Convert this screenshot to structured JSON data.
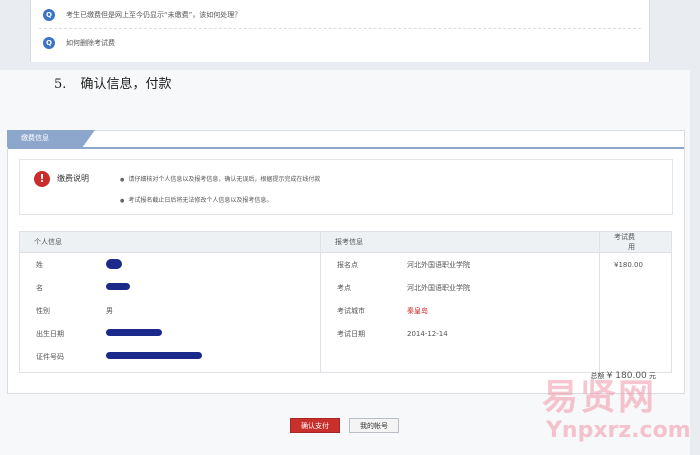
{
  "faq": [
    {
      "icon": "Q",
      "text": "考生已缴费但是网上至今仍显示“未缴费”，该如何处理？"
    },
    {
      "icon": "Q",
      "text": "如何删除考试费"
    }
  ],
  "step": {
    "number": "5.",
    "title": "确认信息，付款"
  },
  "panel": {
    "tab": "缴费信息",
    "notice": {
      "icon": "!",
      "title": "缴费说明",
      "lines": [
        "请仔细核对个人信息以及报考信息，确认无误后，根据提示完成在线付款",
        "考试报名截止日后将无法修改个人信息以及报考信息。"
      ]
    },
    "table": {
      "headers": [
        "个人信息",
        "报考信息",
        "考试费用"
      ],
      "personal": [
        {
          "label": "姓",
          "value": "",
          "masked": true
        },
        {
          "label": "名",
          "value": "",
          "masked": true
        },
        {
          "label": "性别",
          "value": "男",
          "masked": false
        },
        {
          "label": "出生日期",
          "value": "",
          "masked": true
        },
        {
          "label": "证件号码",
          "value": "",
          "masked": true
        }
      ],
      "exam": [
        {
          "label": "报名点",
          "value": "河北外国语职业学院"
        },
        {
          "label": "考点",
          "value": "河北外国语职业学院"
        },
        {
          "label": "考试城市",
          "value": "秦皇岛"
        },
        {
          "label": "考试日期",
          "value": "2014-12-14"
        }
      ],
      "fee": "¥180.00"
    },
    "total": {
      "label": "总额",
      "amount": "¥ 180.00",
      "unit": "元"
    }
  },
  "buttons": {
    "confirm": "确认支付",
    "mine": "我的帐号"
  },
  "watermark": {
    "cn": "易贤网",
    "url": "Ynpxrz.com"
  },
  "colors": {
    "accent": "#8da7cc",
    "confirm": "#c9302c",
    "alert": "#cc2b2b",
    "mask": "#1b2a8a"
  }
}
